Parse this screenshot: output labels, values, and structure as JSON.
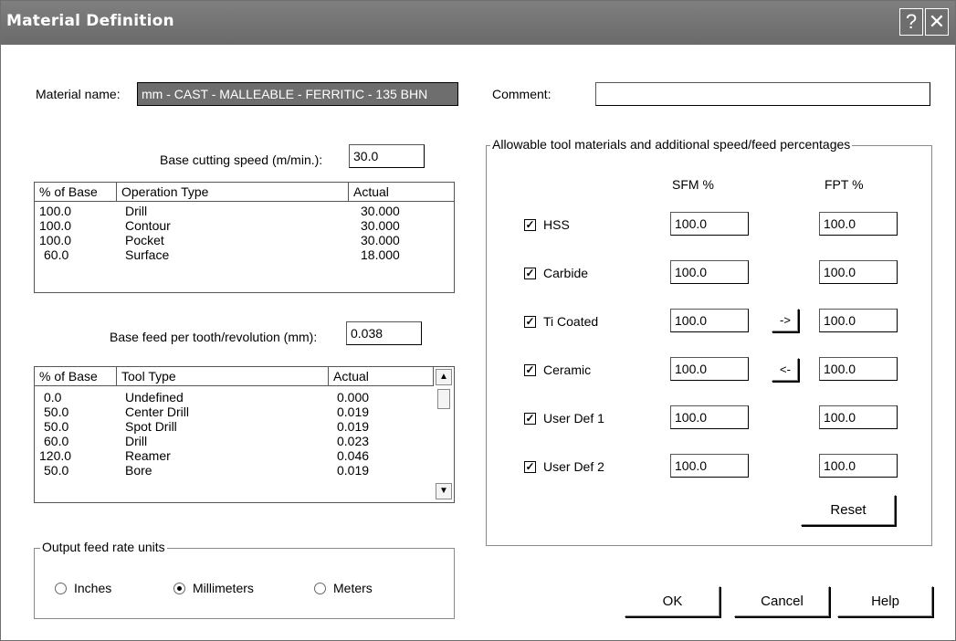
{
  "window": {
    "title": "Material Definition",
    "help_glyph": "?",
    "close_glyph": "✕"
  },
  "material": {
    "name_label": "Material name:",
    "name_value": "mm - CAST - MALLEABLE - FERRITIC - 135 BHN"
  },
  "comment": {
    "label": "Comment:",
    "value": ""
  },
  "base_speed": {
    "label": "Base cutting speed (m/min.):",
    "value": "30.0"
  },
  "operations": {
    "headers": [
      "% of Base",
      "Operation Type",
      "Actual"
    ],
    "rows": [
      [
        "100.0",
        "Drill",
        "30.000"
      ],
      [
        "100.0",
        "Contour",
        "30.000"
      ],
      [
        "100.0",
        "Pocket",
        "30.000"
      ],
      [
        "60.0",
        "Surface",
        "18.000"
      ]
    ]
  },
  "base_feed": {
    "label": "Base feed per tooth/revolution (mm):",
    "value": "0.038"
  },
  "tools": {
    "headers": [
      "% of Base",
      "Tool Type",
      "Actual"
    ],
    "rows": [
      [
        "0.0",
        "Undefined",
        "0.000"
      ],
      [
        "50.0",
        "Center Drill",
        "0.019"
      ],
      [
        "50.0",
        "Spot Drill",
        "0.019"
      ],
      [
        "60.0",
        "Drill",
        "0.023"
      ],
      [
        "120.0",
        "Reamer",
        "0.046"
      ],
      [
        "50.0",
        "Bore",
        "0.019"
      ]
    ]
  },
  "output_units": {
    "legend": "Output feed rate units",
    "options": [
      "Inches",
      "Millimeters",
      "Meters"
    ],
    "selected": "Millimeters"
  },
  "allowable": {
    "legend": "Allowable tool materials and additional speed/feed percentages",
    "sfm_header": "SFM %",
    "fpt_header": "FPT %",
    "rows": [
      {
        "name": "HSS",
        "checked": true,
        "sfm": "100.0",
        "fpt": "100.0"
      },
      {
        "name": "Carbide",
        "checked": true,
        "sfm": "100.0",
        "fpt": "100.0"
      },
      {
        "name": "Ti Coated",
        "checked": true,
        "sfm": "100.0",
        "fpt": "100.0"
      },
      {
        "name": "Ceramic",
        "checked": true,
        "sfm": "100.0",
        "fpt": "100.0"
      },
      {
        "name": "User Def 1",
        "checked": true,
        "sfm": "100.0",
        "fpt": "100.0"
      },
      {
        "name": "User Def 2",
        "checked": true,
        "sfm": "100.0",
        "fpt": "100.0"
      }
    ],
    "copy_right_label": "->",
    "copy_left_label": "<-",
    "reset_label": "Reset"
  },
  "buttons": {
    "ok": "OK",
    "cancel": "Cancel",
    "help": "Help"
  },
  "colors": {
    "titlebar": "#6e6e6e",
    "selection": "#6e6e6e"
  }
}
